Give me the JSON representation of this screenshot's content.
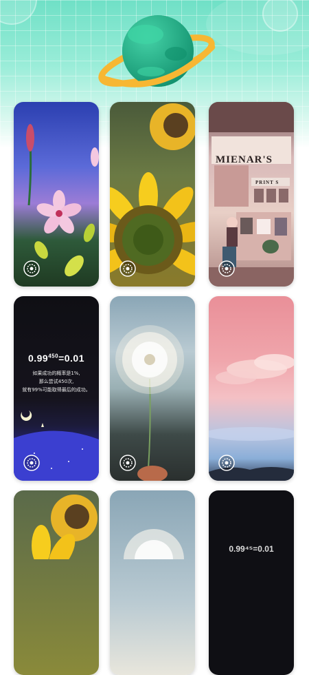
{
  "header": {
    "illustration": "planet-with-ring",
    "colors": {
      "top": "#6fe0c6",
      "planet": "#1fb58a",
      "ring": "#f7b733"
    }
  },
  "wallpapers": [
    {
      "id": "flower-dusk",
      "theme": "pink flower at dusk"
    },
    {
      "id": "sunflower-1",
      "theme": "sunflower"
    },
    {
      "id": "shop-front",
      "theme": "pixel shop front",
      "sign": "MIENAR'S",
      "subsign": "PRINT S"
    },
    {
      "id": "quote-card",
      "formula_base": "0.99",
      "formula_exp": "450",
      "formula_tail": "=0.01",
      "lines": [
        "如果成功的概率是1%,",
        "那么尝试450次,",
        "就有99%可能取得最后的成功。"
      ]
    },
    {
      "id": "dandelion",
      "theme": "dandelion"
    },
    {
      "id": "pink-sky",
      "theme": "pink sky clouds"
    },
    {
      "id": "sunflower-2",
      "theme": "sunflower"
    },
    {
      "id": "dandelion-2",
      "theme": "dandelion"
    },
    {
      "id": "quote-card-2",
      "formula_partial": "0.99⁴⁵=0.01"
    }
  ],
  "button_icon": "live-wallpaper-icon"
}
